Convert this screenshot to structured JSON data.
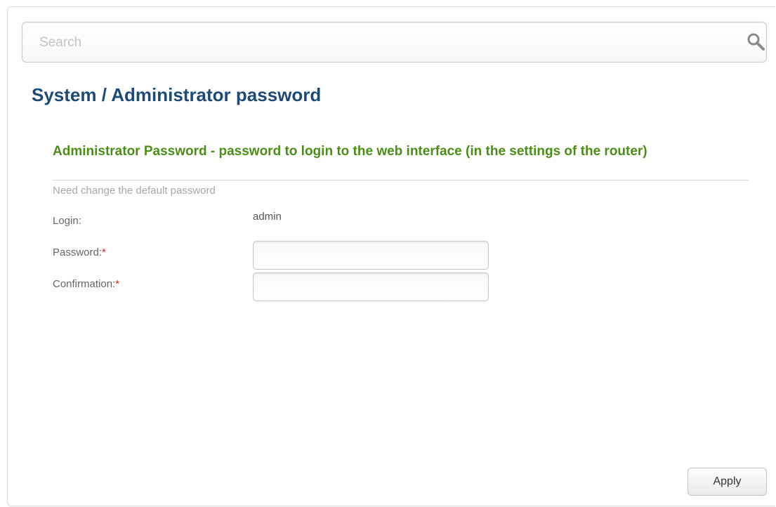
{
  "search": {
    "placeholder": "Search",
    "icon": "search-icon"
  },
  "breadcrumb": {
    "parent": "System",
    "separator": " / ",
    "current": "Administrator password"
  },
  "section": {
    "title": "Administrator Password - password to login to the web interface (in the settings of the router)",
    "hint": "Need change the default password"
  },
  "form": {
    "login": {
      "label": "Login:",
      "value": "admin"
    },
    "password": {
      "label": "Password:",
      "required_mark": "*",
      "value": ""
    },
    "confirmation": {
      "label": "Confirmation:",
      "required_mark": "*",
      "value": ""
    }
  },
  "actions": {
    "apply_label": "Apply"
  },
  "colors": {
    "title": "#1f4a73",
    "section_title": "#4d8b1a",
    "required": "#d32323",
    "hint": "#a8a8a8"
  }
}
